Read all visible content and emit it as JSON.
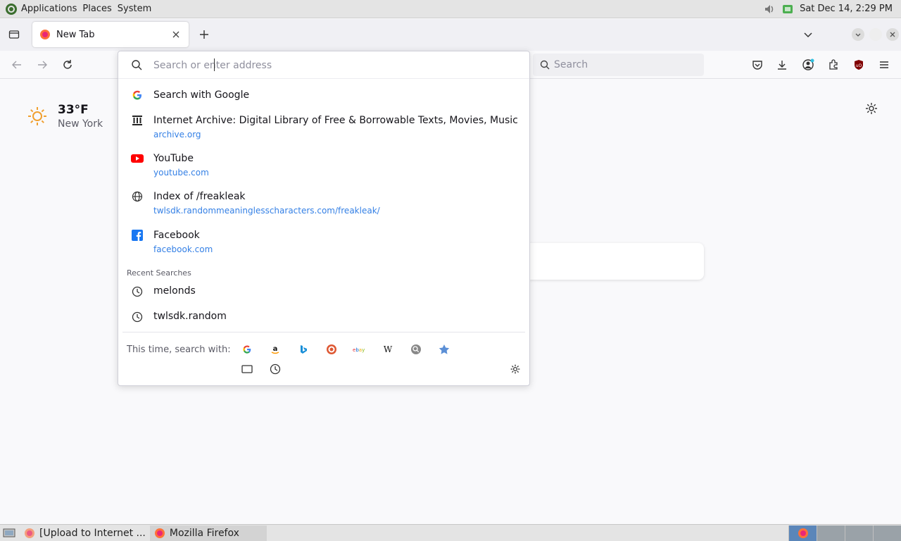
{
  "top_panel": {
    "menu": [
      "Applications",
      "Places",
      "System"
    ],
    "clock": "Sat Dec 14,  2:29 PM"
  },
  "tabs": [
    {
      "title": "New Tab"
    }
  ],
  "url_input": {
    "placeholder": "Search or enter address",
    "value": ""
  },
  "search_bar": {
    "placeholder": "Search"
  },
  "suggestions": [
    {
      "icon": "google-icon",
      "title": "Search with Google",
      "url": ""
    },
    {
      "icon": "archive-icon",
      "title": "Internet Archive: Digital Library of Free & Borrowable Texts, Movies, Music & Wayba",
      "url": "archive.org"
    },
    {
      "icon": "youtube-icon",
      "title": "YouTube",
      "url": "youtube.com"
    },
    {
      "icon": "globe-icon",
      "title": "Index of /freakleak",
      "url": "twlsdk.randommeaninglesscharacters.com/freakleak/"
    },
    {
      "icon": "facebook-icon",
      "title": "Facebook",
      "url": "facebook.com"
    }
  ],
  "recent_searches": {
    "label": "Recent Searches",
    "items": [
      "melonds",
      "twlsdk.random"
    ]
  },
  "engines": {
    "label": "This time, search with:",
    "items": [
      "google",
      "amazon",
      "bing",
      "duckduckgo",
      "ebay",
      "wikipedia",
      "search",
      "bookmarks",
      "tabs",
      "history"
    ]
  },
  "weather": {
    "temperature": "33°F",
    "location": "New York"
  },
  "taskbar": {
    "tasks": [
      "[Upload to Internet ...",
      "Mozilla Firefox"
    ]
  },
  "colors": {
    "accent": "#0060df",
    "youtube": "#ff0000",
    "facebook": "#1877f2"
  }
}
